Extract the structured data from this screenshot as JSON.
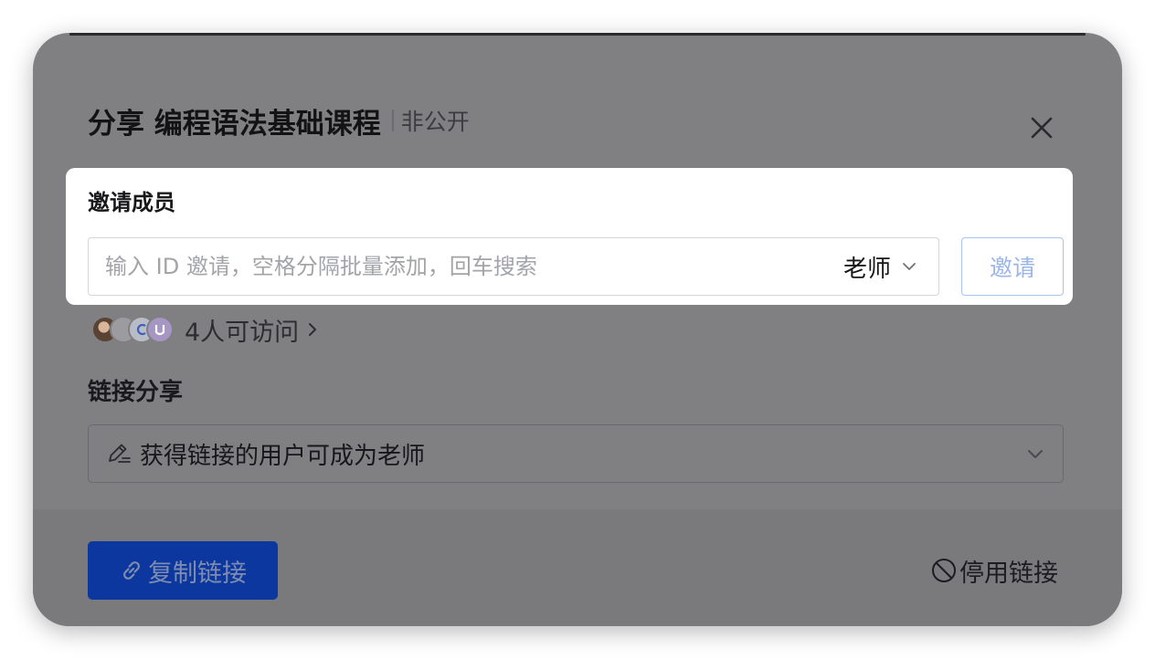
{
  "dialog": {
    "title": "分享 编程语法基础课程",
    "visibility": "非公开"
  },
  "invite": {
    "label": "邀请成员",
    "placeholder": "输入 ID 邀请，空格分隔批量添加，回车搜索",
    "role_selected": "老师",
    "button_label": "邀请"
  },
  "access": {
    "text": "4人可访问"
  },
  "link_share": {
    "label": "链接分享",
    "permission": "获得链接的用户可成为老师"
  },
  "footer": {
    "copy_label": "复制链接",
    "disable_label": "停用链接"
  },
  "colors": {
    "overlay": "#808082",
    "primary": "#0c379e",
    "invite_button_border": "#a9c3ef"
  },
  "icons": [
    "close-icon",
    "chevron-down-icon",
    "chevron-right-icon",
    "edit-icon",
    "link-icon",
    "ban-icon"
  ]
}
